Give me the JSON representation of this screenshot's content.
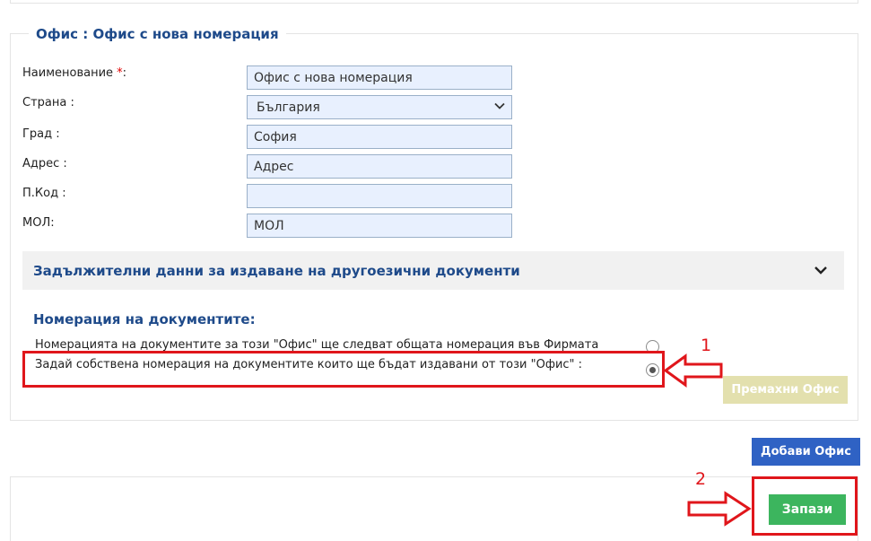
{
  "office_panel": {
    "legend": "Офис : Офис с нова номерация",
    "fields": [
      {
        "label": "Наименование ",
        "required": "*",
        "colon": ":",
        "value": "Офис с нова номерация"
      },
      {
        "label": "Страна :",
        "value": "България"
      },
      {
        "label": "Град :",
        "value": "София"
      },
      {
        "label": "Адрес :",
        "value": "Адрес"
      },
      {
        "label": "П.Код :",
        "value": ""
      },
      {
        "label": "МОЛ:",
        "value": "МОЛ"
      }
    ],
    "accordion_title": "Задължителни данни за издаване на другоезични документи",
    "numbering": {
      "title": "Номерация на документите:",
      "option_1": "Номерацията на документите за този \"Офис\" ще следват общата номерация във Фирмата",
      "option_2": "Задай собствена номерация на документите които ще бъдат издавани от този \"Офис\" :",
      "selected": 2
    },
    "remove_button": "Премахни Офис"
  },
  "add_office_button": "Добави Офис",
  "save_button": "Запази",
  "annotations": {
    "num_1": "1",
    "num_2": "2",
    "color": "#e0161b"
  }
}
